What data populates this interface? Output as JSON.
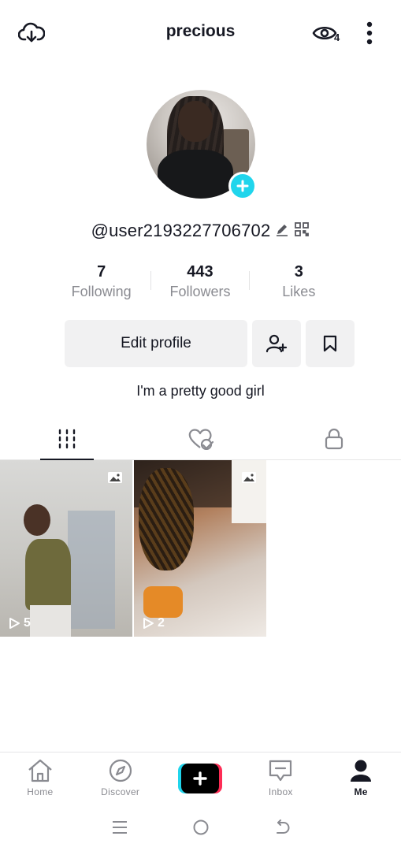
{
  "header": {
    "title": "precious",
    "viewer_count": "4",
    "icons": {
      "left": "cloud-download-icon",
      "eye": "eye-icon",
      "more": "more-vertical-icon"
    }
  },
  "profile": {
    "username": "@user2193227706702",
    "bio": "I'm a pretty good girl",
    "icons": {
      "edit": "pencil-icon",
      "qr": "qr-code-icon",
      "add_avatar": "plus-icon"
    }
  },
  "stats": [
    {
      "value": "7",
      "label": "Following"
    },
    {
      "value": "443",
      "label": "Followers"
    },
    {
      "value": "3",
      "label": "Likes"
    }
  ],
  "actions": {
    "edit_profile": "Edit profile",
    "icons": {
      "add_friend": "add-user-icon",
      "saved": "bookmark-icon"
    }
  },
  "tabs": [
    {
      "icon": "grid-icon",
      "active": true
    },
    {
      "icon": "liked-heart-icon",
      "active": false
    },
    {
      "icon": "lock-icon",
      "active": false
    }
  ],
  "videos": [
    {
      "plays": "5",
      "type_icon": "photo-icon"
    },
    {
      "plays": "2",
      "type_icon": "photo-icon"
    }
  ],
  "bottom_nav": {
    "items": [
      {
        "label": "Home",
        "icon": "home-icon"
      },
      {
        "label": "Discover",
        "icon": "compass-icon"
      },
      {
        "label": "",
        "icon": "create-plus-icon"
      },
      {
        "label": "Inbox",
        "icon": "inbox-icon"
      },
      {
        "label": "Me",
        "icon": "profile-icon"
      }
    ]
  },
  "system_nav": {
    "icons": [
      "menu-icon",
      "home-circle-icon",
      "back-icon"
    ]
  },
  "colors": {
    "accent_cyan": "#20d5ec",
    "accent_red": "#fe2c55",
    "text": "#161823",
    "muted": "#8a8b91",
    "button_bg": "#f1f1f2"
  }
}
